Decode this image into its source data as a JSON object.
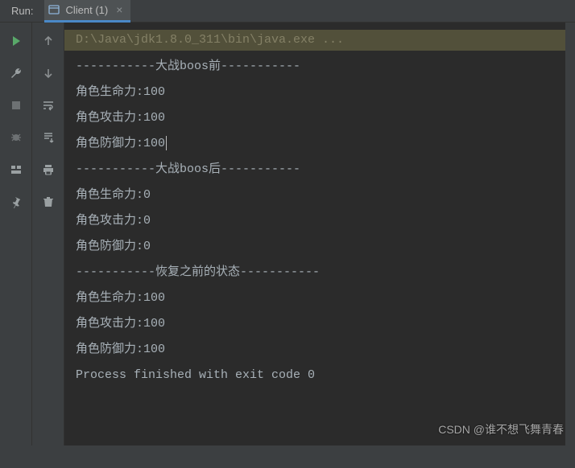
{
  "header": {
    "run_label": "Run:",
    "tab_label": "Client (1)"
  },
  "icons": {
    "tab_icon": "window-icon",
    "close": "close-icon"
  },
  "left_toolbar": [
    {
      "name": "run-icon",
      "interactable": true
    },
    {
      "name": "wrench-icon",
      "interactable": true
    },
    {
      "name": "stop-icon",
      "interactable": true
    },
    {
      "name": "bug-stop-icon",
      "interactable": true
    },
    {
      "name": "layout-icon",
      "interactable": true
    },
    {
      "name": "pin-icon",
      "interactable": true
    }
  ],
  "mid_toolbar": [
    {
      "name": "arrow-up-icon",
      "interactable": true
    },
    {
      "name": "arrow-down-icon",
      "interactable": true
    },
    {
      "name": "wrap-icon",
      "interactable": true
    },
    {
      "name": "scroll-end-icon",
      "interactable": true
    },
    {
      "name": "print-icon",
      "interactable": true
    },
    {
      "name": "trash-icon",
      "interactable": true
    }
  ],
  "console": {
    "command": "D:\\Java\\jdk1.8.0_311\\bin\\java.exe ...",
    "lines": [
      "-----------大战boos前-----------",
      "角色生命力:100",
      "角色攻击力:100",
      "角色防御力:100",
      "-----------大战boos后-----------",
      "角色生命力:0",
      "角色攻击力:0",
      "角色防御力:0",
      "-----------恢复之前的状态-----------",
      "角色生命力:100",
      "角色攻击力:100",
      "角色防御力:100",
      "",
      "Process finished with exit code 0"
    ],
    "cursor_line_index": 3
  },
  "watermark": "CSDN @谁不想飞舞青春"
}
